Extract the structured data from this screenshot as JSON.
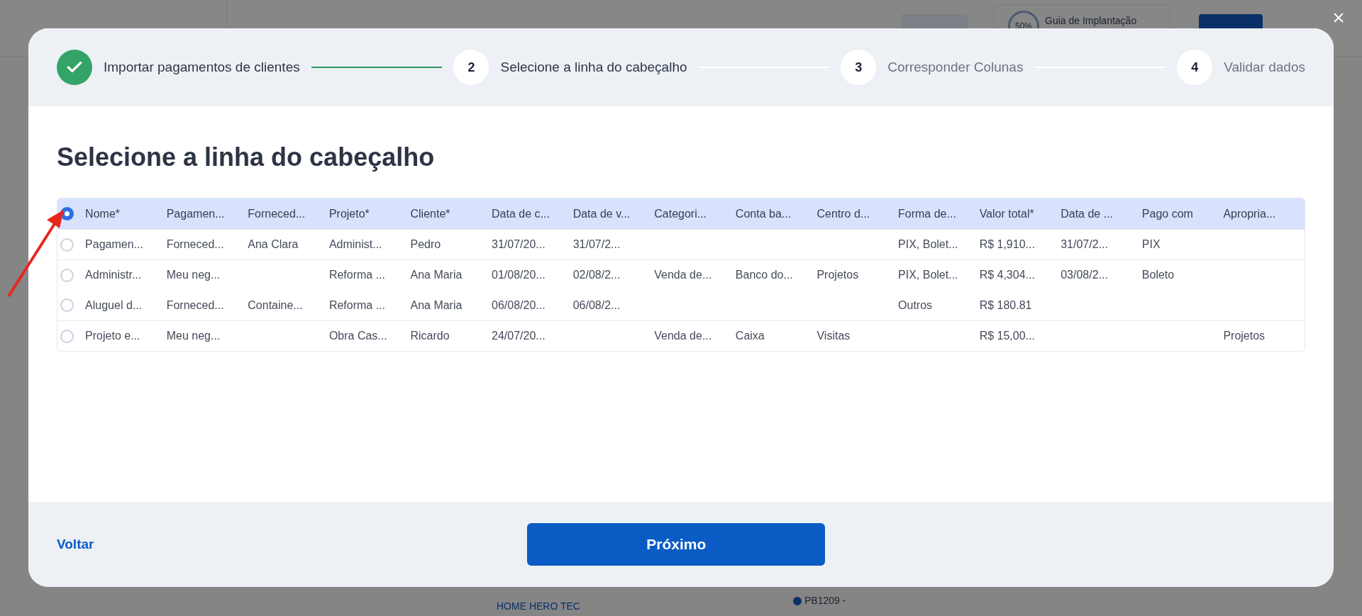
{
  "background": {
    "guide": {
      "percent": "50%",
      "label": "Guia de Implantação"
    },
    "list_row": {
      "client": "HOME HERO TEC",
      "code": "PB1209 -"
    }
  },
  "steps": [
    {
      "label": "Importar pagamentos de clientes",
      "kind": "done"
    },
    {
      "number": "2",
      "label": "Selecione a linha do cabeçalho",
      "kind": "current"
    },
    {
      "number": "3",
      "label": "Corresponder Colunas",
      "kind": "pending"
    },
    {
      "number": "4",
      "label": "Validar dados",
      "kind": "pending"
    }
  ],
  "heading": "Selecione a linha do cabeçalho",
  "table": {
    "rows": [
      {
        "selected": true,
        "divider_above": false,
        "cells": [
          "Nome*",
          "Pagamen...",
          "Forneced...",
          "Projeto*",
          "Cliente*",
          "Data de c...",
          "Data de v...",
          "Categori...",
          "Conta ba...",
          "Centro d...",
          "Forma de...",
          "Valor total*",
          "Data de ...",
          "Pago com",
          "Apropria..."
        ]
      },
      {
        "selected": false,
        "divider_above": true,
        "cells": [
          "Pagamen...",
          "Forneced...",
          "Ana Clara",
          "Administ...",
          "Pedro",
          "31/07/20...",
          "31/07/2...",
          "",
          "",
          "",
          "PIX, Bolet...",
          "R$ 1,910...",
          "31/07/2...",
          "PIX",
          ""
        ]
      },
      {
        "selected": false,
        "divider_above": true,
        "cells": [
          "Administr...",
          "Meu neg...",
          "",
          "Reforma ...",
          "Ana Maria",
          "01/08/20...",
          "02/08/2...",
          "Venda de...",
          "Banco do...",
          "Projetos",
          "PIX, Bolet...",
          "R$ 4,304...",
          "03/08/2...",
          "Boleto",
          ""
        ]
      },
      {
        "selected": false,
        "divider_above": false,
        "cells": [
          "Aluguel d...",
          "Forneced...",
          "Containe...",
          "Reforma ...",
          "Ana Maria",
          "06/08/20...",
          "06/08/2...",
          "",
          "",
          "",
          "Outros",
          "R$ 180.81",
          "",
          "",
          ""
        ]
      },
      {
        "selected": false,
        "divider_above": true,
        "cells": [
          "Projeto e...",
          "Meu neg...",
          "",
          "Obra Cas...",
          "Ricardo",
          "24/07/20...",
          "",
          "Venda de...",
          "Caixa",
          "Visitas",
          "",
          "R$ 15,00...",
          "",
          "",
          "Projetos"
        ]
      }
    ]
  },
  "back_link": "Voltar",
  "next_button": "Próximo"
}
